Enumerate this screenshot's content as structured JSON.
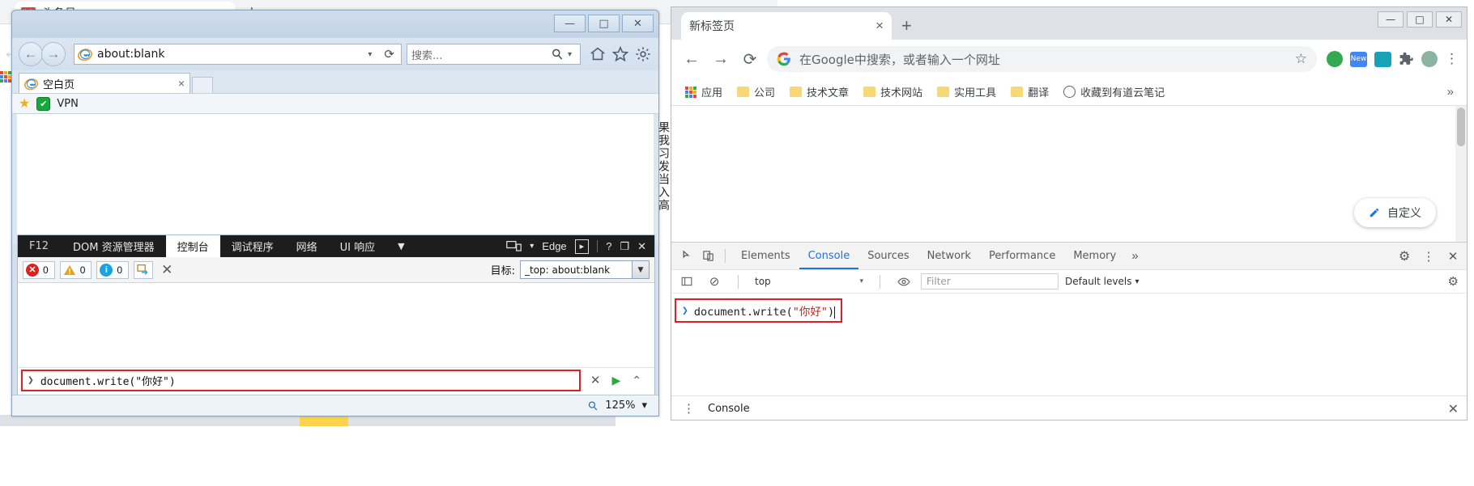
{
  "background_browser": {
    "tab_title": "头条号",
    "tab_favicon_label": "头条",
    "new_tab_label": "+",
    "close_label": "×",
    "back_arrow": "←",
    "vertical_text": "果我习发当入高",
    "dot_colors": [
      "#e8453c",
      "#f9ab00",
      "#34a853",
      "#4285f4",
      "#e8453c",
      "#f9ab00",
      "#34a853",
      "#4285f4",
      "#e8453c"
    ]
  },
  "ie_window": {
    "title": "",
    "window_buttons": {
      "minimize": "—",
      "maximize": "□",
      "close": "✕"
    },
    "nav": {
      "back": "←",
      "forward": "→"
    },
    "address": {
      "url": "about:blank",
      "dropdown_caret": "▾",
      "refresh": "⟳"
    },
    "search": {
      "placeholder": "搜索...",
      "dropdown_caret": "▾"
    },
    "toolbar_icons": [
      "home-icon",
      "favorites-star-icon",
      "settings-gear-icon"
    ],
    "tab": {
      "title": "空白页",
      "close": "×"
    },
    "favorites_bar": {
      "star": "★",
      "vpn_label": "VPN",
      "vpn_badge": "✔"
    },
    "statusbar": {
      "zoom": "125%",
      "zoom_caret": "▾"
    }
  },
  "ie_devtools": {
    "tabs": [
      {
        "label": "F12",
        "active": false
      },
      {
        "label": "DOM 资源管理器",
        "active": false
      },
      {
        "label": "控制台",
        "active": true
      },
      {
        "label": "调试程序",
        "active": false
      },
      {
        "label": "网络",
        "active": false
      },
      {
        "label": "UI 响应",
        "active": false
      }
    ],
    "overflow_caret": "▼",
    "right_controls": {
      "emulation_label": "Edge",
      "emulation_caret": "▾",
      "console_toggle": "〉",
      "help": "?",
      "dock": "❐",
      "close": "✕"
    },
    "counters": [
      {
        "name": "errors",
        "value": "0",
        "color": "#e02020"
      },
      {
        "name": "warnings",
        "value": "0",
        "color": "#e8a317"
      },
      {
        "name": "info",
        "value": "0",
        "color": "#19a3e0"
      }
    ],
    "clear_on_navigate": "clear-on-navigate-icon",
    "clear_label": "✕",
    "target": {
      "label": "目标:",
      "value": "_top: about:blank",
      "caret": "⌄"
    },
    "command": {
      "prompt": "❯",
      "text": "document.write(\"你好\")"
    },
    "command_actions": {
      "cancel": "✕",
      "run": "▶",
      "expand": "⌃"
    }
  },
  "chrome_window": {
    "window_buttons": {
      "minimize": "—",
      "maximize": "□",
      "close": "✕"
    },
    "tab": {
      "title": "新标签页",
      "close": "×"
    },
    "new_tab": "+",
    "nav": {
      "back": "←",
      "forward": "→",
      "reload": "⟳"
    },
    "omnibox": {
      "placeholder": "在Google中搜索，或者输入一个网址",
      "google_icon": "google-g-icon",
      "star": "☆"
    },
    "toolbar_extensions": [
      {
        "name": "profile-green-circle-icon",
        "color": "#34a853",
        "label": ""
      },
      {
        "name": "new-extension-icon",
        "color": "#4285f4",
        "label": "New"
      },
      {
        "name": "extension-teal-icon",
        "color": "#17a2b8",
        "label": ""
      },
      {
        "name": "puzzle-extensions-icon",
        "color": "#5f6368",
        "label": ""
      },
      {
        "name": "avatar-icon",
        "color": "#8ab4a0",
        "label": ""
      }
    ],
    "menu_kebab": "⋮",
    "bookmarks": [
      {
        "label": "应用",
        "icon": "apps-grid-icon"
      },
      {
        "label": "公司",
        "icon": "folder-icon"
      },
      {
        "label": "技术文章",
        "icon": "folder-icon"
      },
      {
        "label": "技术网站",
        "icon": "folder-icon"
      },
      {
        "label": "实用工具",
        "icon": "folder-icon"
      },
      {
        "label": "翻译",
        "icon": "folder-icon"
      },
      {
        "label": "收藏到有道云笔记",
        "icon": "globe-icon"
      }
    ],
    "bookmarks_overflow": "»",
    "customize_button": {
      "label": "自定义",
      "icon": "pencil-icon"
    }
  },
  "chrome_devtools": {
    "left_icons": [
      "inspect-element-icon",
      "device-toolbar-icon"
    ],
    "tabs": [
      {
        "label": "Elements",
        "active": false
      },
      {
        "label": "Console",
        "active": true
      },
      {
        "label": "Sources",
        "active": false
      },
      {
        "label": "Network",
        "active": false
      },
      {
        "label": "Performance",
        "active": false
      },
      {
        "label": "Memory",
        "active": false
      }
    ],
    "tabs_overflow": "»",
    "right_icons": {
      "settings": "⚙",
      "kebab": "⋮",
      "close": "✕"
    },
    "filterbar": {
      "sidebar_toggle": "console-sidebar-icon",
      "clear_console": "⊘",
      "context": "top",
      "context_caret": "▾",
      "eye_icon": "◉",
      "filter_placeholder": "Filter",
      "levels_label": "Default levels",
      "levels_caret": "▾",
      "settings_gear": "⚙"
    },
    "command": {
      "prompt": "❯",
      "code_plain_1": "document.write(",
      "code_string": "\"你好\"",
      "code_plain_2": ")"
    },
    "drawer": {
      "kebab": "⋮",
      "tab_label": "Console",
      "close": "✕"
    }
  }
}
